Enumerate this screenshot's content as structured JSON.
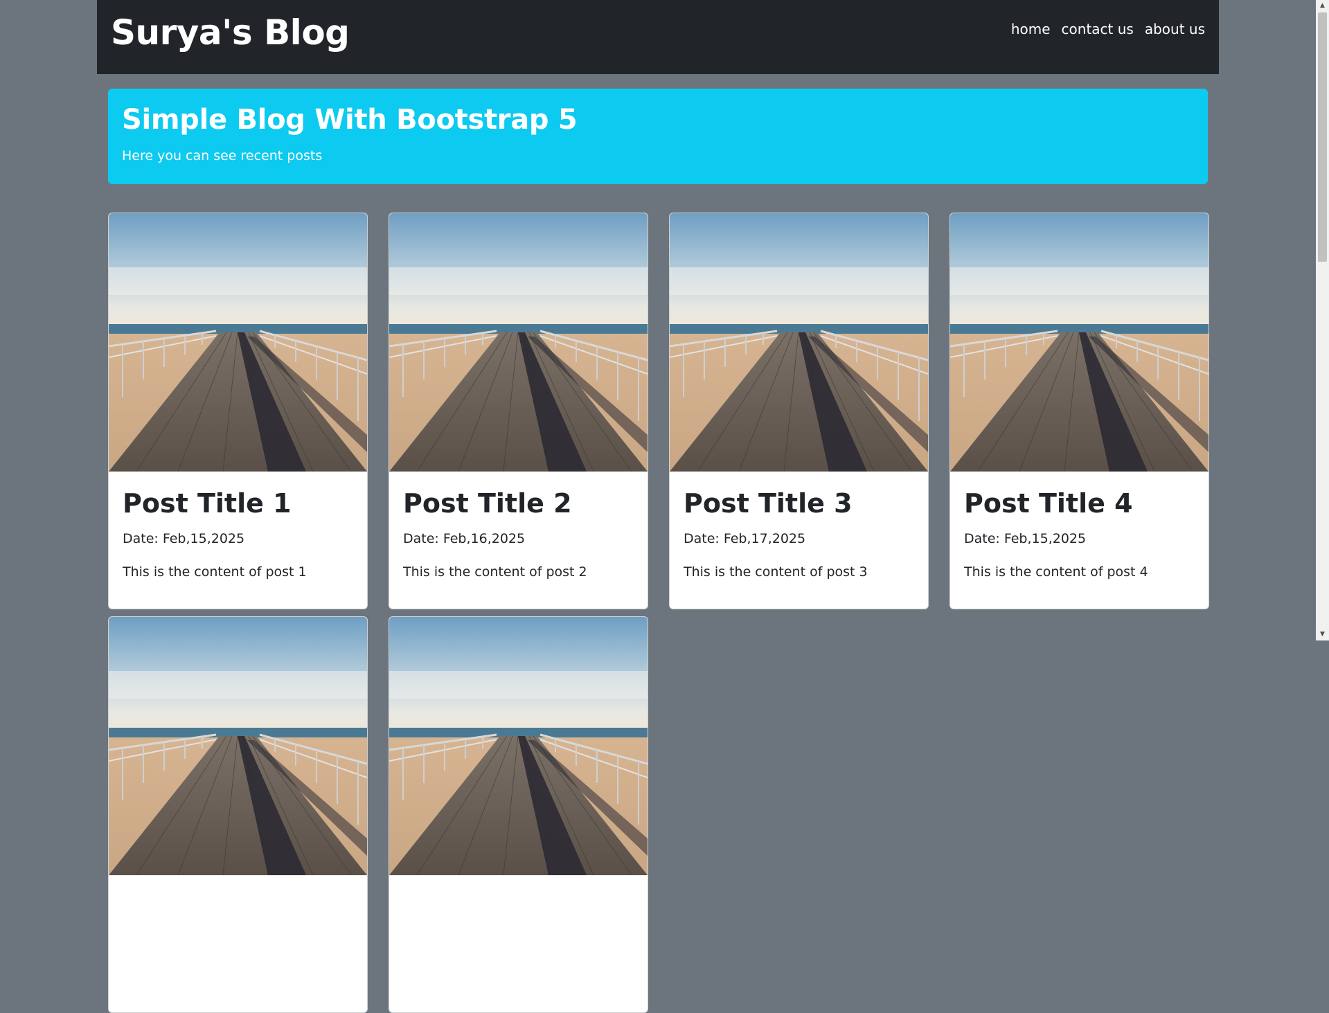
{
  "navbar": {
    "brand": "Surya's Blog",
    "links": [
      {
        "label": "home"
      },
      {
        "label": "contact us"
      },
      {
        "label": "about us"
      }
    ]
  },
  "hero": {
    "title": "Simple Blog With Bootstrap 5",
    "subtitle": "Here you can see recent posts"
  },
  "posts": [
    {
      "title": "Post Title 1",
      "date": "Date: Feb,15,2025",
      "content": "This is the content of post 1"
    },
    {
      "title": "Post Title 2",
      "date": "Date: Feb,16,2025",
      "content": "This is the content of post 2"
    },
    {
      "title": "Post Title 3",
      "date": "Date: Feb,17,2025",
      "content": "This is the content of post 3"
    },
    {
      "title": "Post Title 4",
      "date": "Date: Feb,15,2025",
      "content": "This is the content of post 4"
    },
    {
      "title": "",
      "date": "",
      "content": ""
    },
    {
      "title": "",
      "date": "",
      "content": ""
    }
  ],
  "colors": {
    "page_bg": "#6c757d",
    "navbar_bg": "#212529",
    "hero_bg": "#0dcaf0",
    "card_bg": "#ffffff"
  },
  "icons": {
    "scroll_up": "scroll-up-arrow-icon",
    "scroll_down": "scroll-down-arrow-icon"
  }
}
